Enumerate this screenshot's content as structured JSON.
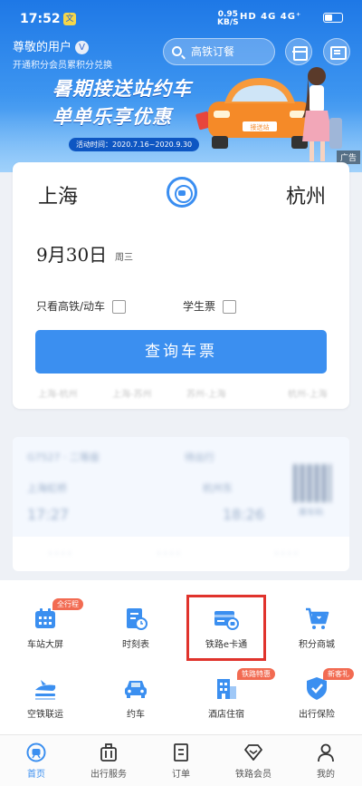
{
  "status_bar": {
    "time": "17:52",
    "net_speed": "0.95",
    "net_unit": "KB/S",
    "signal": "HD 4G 4G⁺",
    "battery_level_pct": 45
  },
  "header": {
    "user_name": "尊敬的用户",
    "vip_badge": "V",
    "user_sub": "开通积分会员累积分兑换",
    "search_placeholder": "高铁订餐"
  },
  "banner": {
    "title": "暑期接送站约车",
    "subtitle": "单单乐享优惠",
    "date_text": "活动时间：2020.7.16~2020.9.30",
    "plate": "接送站",
    "ad_tag": "广告"
  },
  "booking": {
    "from_city": "上海",
    "to_city": "杭州",
    "date": "9月30日",
    "weekday": "周三",
    "option_high_speed": "只看高铁/动车",
    "option_student": "学生票",
    "query_button": "查询车票",
    "history": [
      "上海-杭州",
      "上海-苏州",
      "苏州-上海",
      "杭州-上海"
    ]
  },
  "ticket": {
    "train_code": "G7527 · 二等座",
    "status": "待出行",
    "from": "上海虹桥",
    "to": "杭州东",
    "depart_time": "17:27",
    "arrive_time": "18:26",
    "qr_label": "乘车码"
  },
  "services": [
    {
      "label": "车站大屏",
      "icon": "station-screen-icon",
      "badge": "全行程"
    },
    {
      "label": "时刻表",
      "icon": "timetable-icon",
      "badge": ""
    },
    {
      "label": "铁路e卡通",
      "icon": "e-card-icon",
      "badge": ""
    },
    {
      "label": "积分商城",
      "icon": "cart-icon",
      "badge": ""
    },
    {
      "label": "空铁联运",
      "icon": "plane-train-icon",
      "badge": ""
    },
    {
      "label": "约车",
      "icon": "car-icon",
      "badge": ""
    },
    {
      "label": "酒店住宿",
      "icon": "hotel-icon",
      "badge": "铁路特惠"
    },
    {
      "label": "出行保险",
      "icon": "insurance-icon",
      "badge": "新客礼"
    }
  ],
  "bottom_nav": [
    {
      "label": "首页",
      "icon": "home-icon"
    },
    {
      "label": "出行服务",
      "icon": "luggage-icon"
    },
    {
      "label": "订单",
      "icon": "order-icon"
    },
    {
      "label": "铁路会员",
      "icon": "diamond-icon"
    },
    {
      "label": "我的",
      "icon": "profile-icon"
    }
  ],
  "colors": {
    "primary": "#3b8ff0",
    "banner_top": "#1e78e6",
    "badge": "#f26b52",
    "highlight": "#e0332c",
    "car": "#f58a28"
  }
}
